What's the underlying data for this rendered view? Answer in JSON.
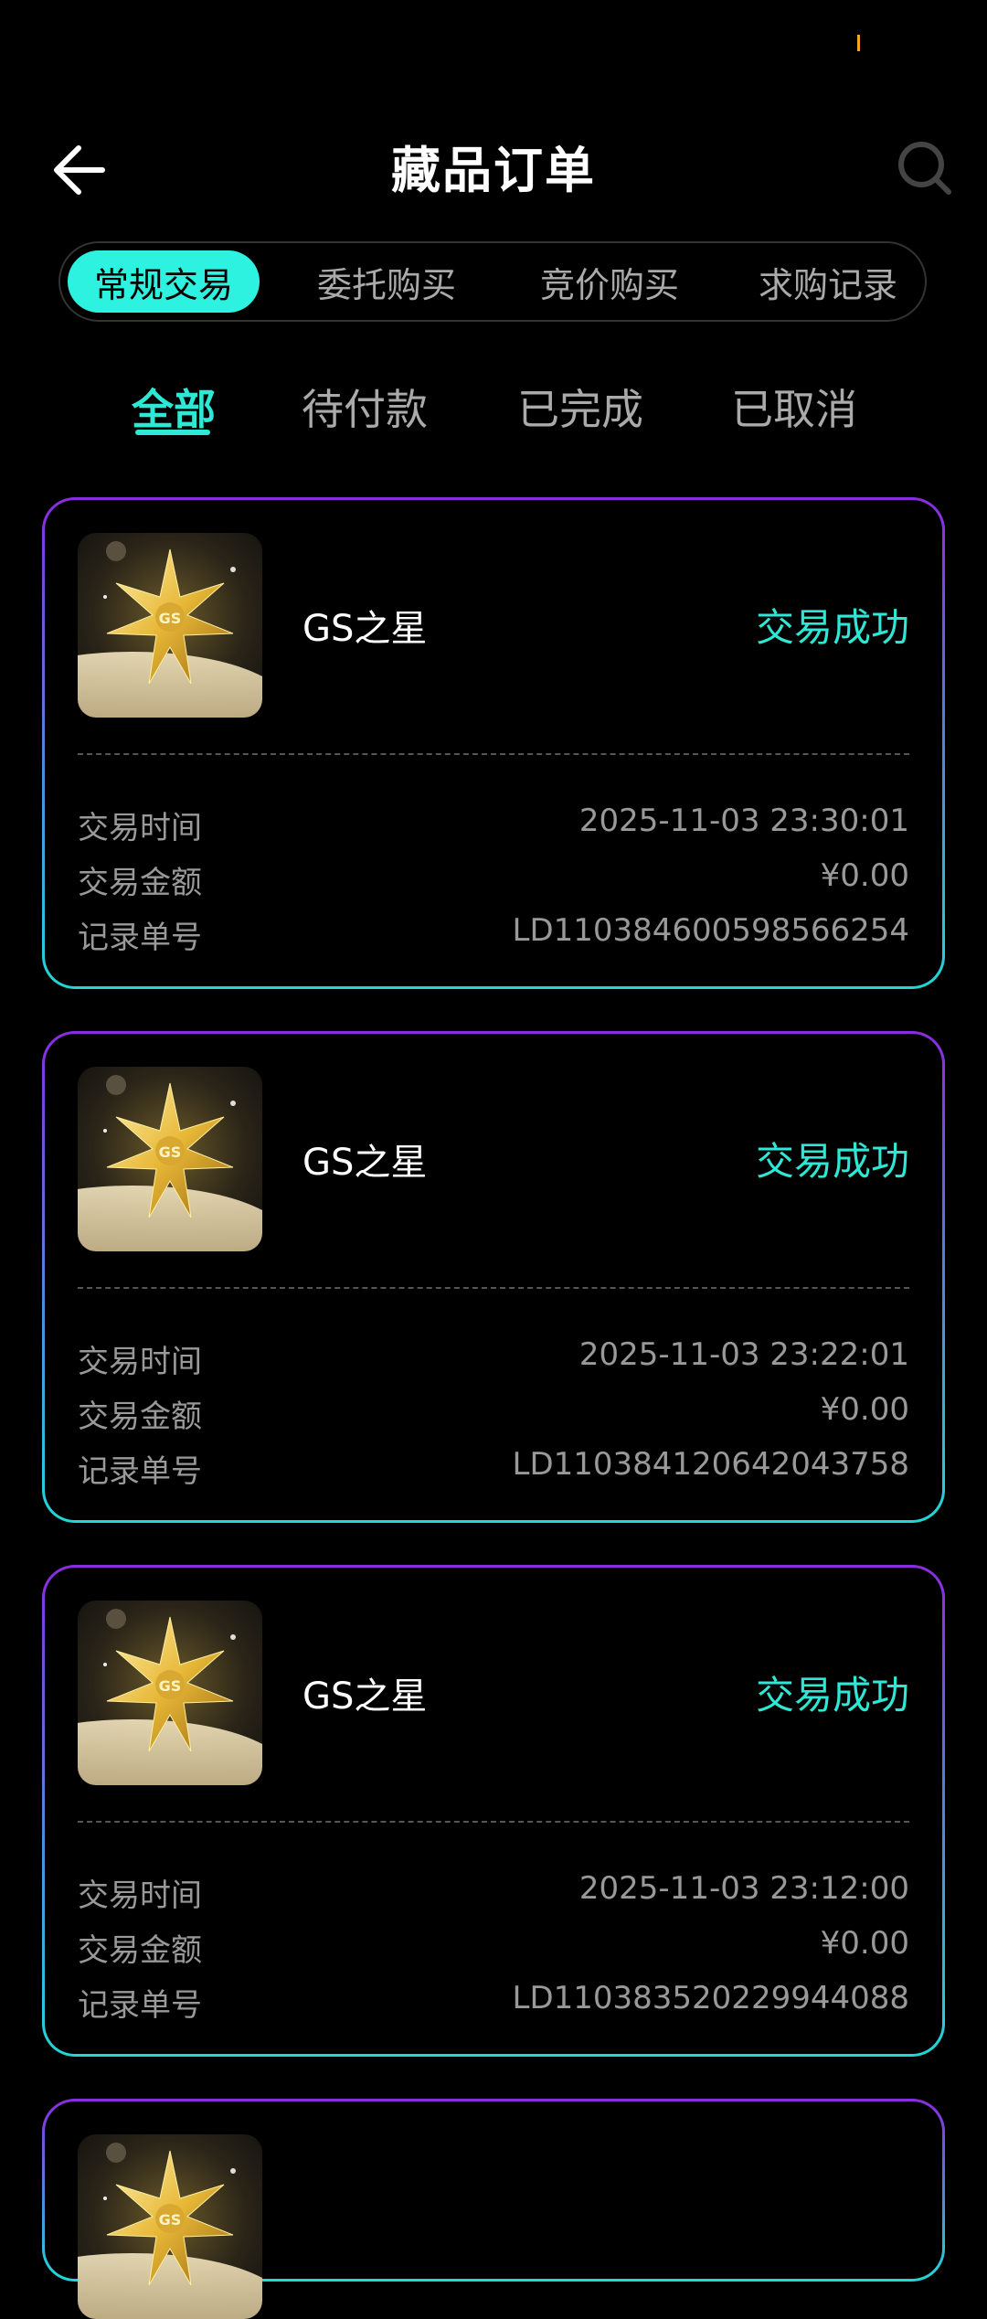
{
  "header": {
    "title": "藏品订单"
  },
  "tabs": [
    "常规交易",
    "委托购买",
    "竞价购买",
    "求购记录"
  ],
  "filters": [
    "全部",
    "待付款",
    "已完成",
    "已取消"
  ],
  "row_labels": {
    "time": "交易时间",
    "amount": "交易金额",
    "record": "记录单号"
  },
  "orders": [
    {
      "name": "GS之星",
      "status": "交易成功",
      "time": "2025-11-03 23:30:01",
      "amount": "¥0.00",
      "record": "LD110384600598566254",
      "thumb_text": "GS"
    },
    {
      "name": "GS之星",
      "status": "交易成功",
      "time": "2025-11-03 23:22:01",
      "amount": "¥0.00",
      "record": "LD110384120642043758",
      "thumb_text": "GS"
    },
    {
      "name": "GS之星",
      "status": "交易成功",
      "time": "2025-11-03 23:12:00",
      "amount": "¥0.00",
      "record": "LD110383520229944088",
      "thumb_text": "GS"
    },
    {
      "thumb_text": "GS"
    }
  ],
  "colors": {
    "accent": "#2ee8d6",
    "tab_active": "#2ef2e0",
    "border_top": "#8a2be2",
    "border_bottom": "#20d8d8"
  },
  "icons": {
    "back": "arrow-left-icon",
    "search": "search-icon",
    "thumb": "gold-star-icon"
  }
}
